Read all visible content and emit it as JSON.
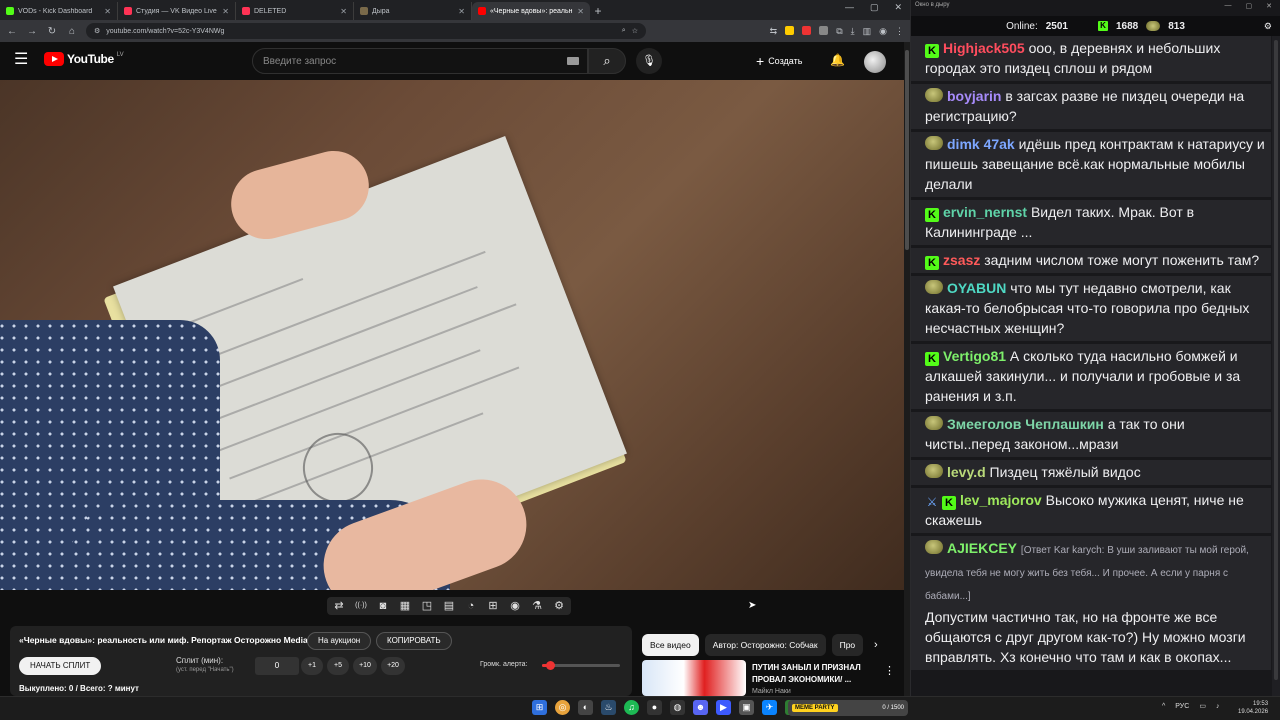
{
  "browser": {
    "tabs": [
      {
        "label": "VODs - Kick Dashboard",
        "color": "#53fc18"
      },
      {
        "label": "Студия — VK Видео Live",
        "color": "#ff3355"
      },
      {
        "label": "DELETED",
        "color": "#ff3355"
      },
      {
        "label": "Дыра",
        "color": "#7a6a4a"
      },
      {
        "label": "«Черные вдовы»: реальн",
        "color": "#ff0000",
        "active": true
      }
    ],
    "url": "youtube.com/watch?v=52c-Y3V4NWg"
  },
  "youtube": {
    "logo_text": "YouTube",
    "country": "LV",
    "search_placeholder": "Введите запрос",
    "create_label": "Создать",
    "toolbar_icons": [
      "loop-icon",
      "broadcast-icon",
      "eye-screen-icon",
      "film-icon",
      "pip-icon",
      "window-icon",
      "speed-icon",
      "caption-icon",
      "camera-icon",
      "flask-icon",
      "gear-icon"
    ],
    "panel": {
      "title": "«Черные вдовы»: реальность или миф. Репортаж Осторожно Media",
      "auction_label": "На аукцион",
      "copy_label": "КОПИРОВАТЬ",
      "start_split_label": "НАЧАТЬ СПЛИТ",
      "split_label": "Сплит (мин):",
      "split_sub": "(уст. перед \"Начать\")",
      "split_value": "0",
      "increments": [
        "+1",
        "+5",
        "+10",
        "+20"
      ],
      "volume_label": "Громк. алерта:",
      "volume_level": 0.1,
      "spent_text": "Выкуплено: 0 / Всего: ? минут"
    },
    "chips": [
      "Все видео",
      "Автор: Осторожно: Собчак",
      "Про"
    ],
    "recommendation": {
      "title": "ПУТИН ЗАНЫЛ И ПРИЗНАЛ ПРОВАЛ ЭКОНОМИКИ/ ...",
      "channel": "Майкл Наки"
    }
  },
  "chat": {
    "window_title": "Окно в дыру",
    "online_label": "Online:",
    "online_count": "2501",
    "kick_count": "1688",
    "vk_count": "813",
    "messages": [
      {
        "badge": "k",
        "user": "Highjack505",
        "color": "#ff4d5e",
        "text": "ооо, в деревнях и небольших городах это пиздец сплош и рядом"
      },
      {
        "badge": "av",
        "user": "boyjarin",
        "color": "#a78bfa",
        "text": "в загсах разве не пиздец очереди на регистрацию?"
      },
      {
        "badge": "av",
        "user": "dimk 47ak",
        "color": "#7da7ff",
        "text": "идёшь пред контрактам к натариусу и пишешь завещание всё.как нормальные мобилы делали"
      },
      {
        "badge": "k",
        "user": "ervin_nernst",
        "color": "#5fd3a8",
        "text": "Видел таких. Мрак. Вот в Калининграде ..."
      },
      {
        "badge": "k",
        "user": "zsasz",
        "color": "#ff5a5a",
        "text": "задним числом тоже могут поженить там?"
      },
      {
        "badge": "av",
        "user": "OYABUN",
        "color": "#4fd9c4",
        "text": "что мы тут недавно смотрели, как какая-то белобрысая что-то говорила про бедных несчастных женщин?"
      },
      {
        "badge": "k",
        "user": "Vertigo81",
        "color": "#7ef06b",
        "text": "А сколько туда насильно бомжей и алкашей закинули... и получали и гробовые и за ранения и з.п."
      },
      {
        "badge": "av",
        "user": "Змееголов Чеплашкин",
        "color": "#7ed6a8",
        "text": "а так то они чисты..перед законом...мрази"
      },
      {
        "badge": "av",
        "user": "levy.d",
        "color": "#b9d97a",
        "text": "Пиздец тяжёлый видос"
      },
      {
        "badge": "modk",
        "user": "lev_majorov",
        "color": "#9ee85c",
        "text": "Высоко мужика ценят, ниче не скажешь"
      },
      {
        "badge": "av",
        "user": "AJIEKCEY",
        "color": "#7ef06b",
        "reply": "[Ответ Kar karych: В уши заливают ты мой герой, увидела тебя не могу жить без тебя... И прочее. А если у парня с бабами...]",
        "text": "Допустим частично так, но на фронте же все общаются с друг другом как-то?) Ну можно мозги вправлять. Хз конечно что там и как в окопах..."
      }
    ]
  },
  "taskbar": {
    "memeparty_label": "MEME PARTY",
    "memeparty_value": "0 / 1500",
    "lang": "РУС",
    "time": "19:53",
    "date": "19.04.2026"
  }
}
